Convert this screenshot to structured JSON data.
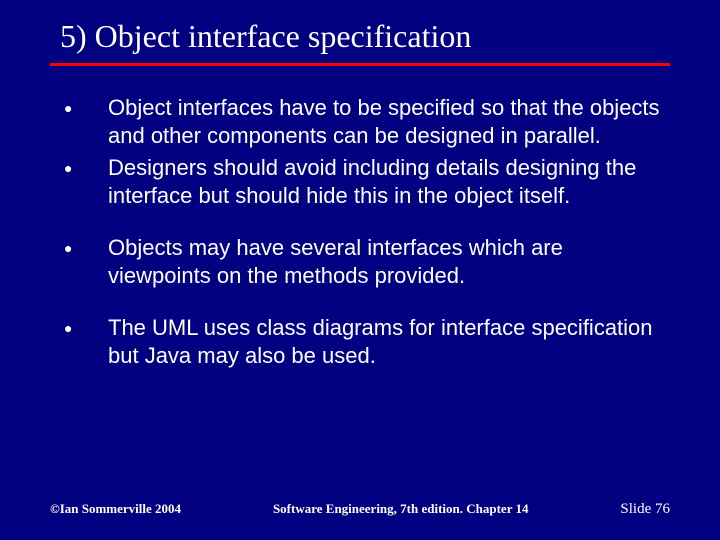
{
  "title": "5) Object interface specification",
  "bullets": [
    {
      "text": "Object interfaces have to be specified so that the objects and other components can be designed in parallel.",
      "gap": false
    },
    {
      "text": "Designers should avoid including details designing the interface but should hide this in the object itself.",
      "gap": false
    },
    {
      "text": "Objects may have several interfaces which are viewpoints on the methods provided.",
      "gap": true
    },
    {
      "text": "The UML uses class diagrams for interface specification but Java may also be used.",
      "gap": true
    }
  ],
  "footer": {
    "left": "©Ian Sommerville 2004",
    "center": "Software Engineering, 7th edition. Chapter 14",
    "right": "Slide 76"
  }
}
